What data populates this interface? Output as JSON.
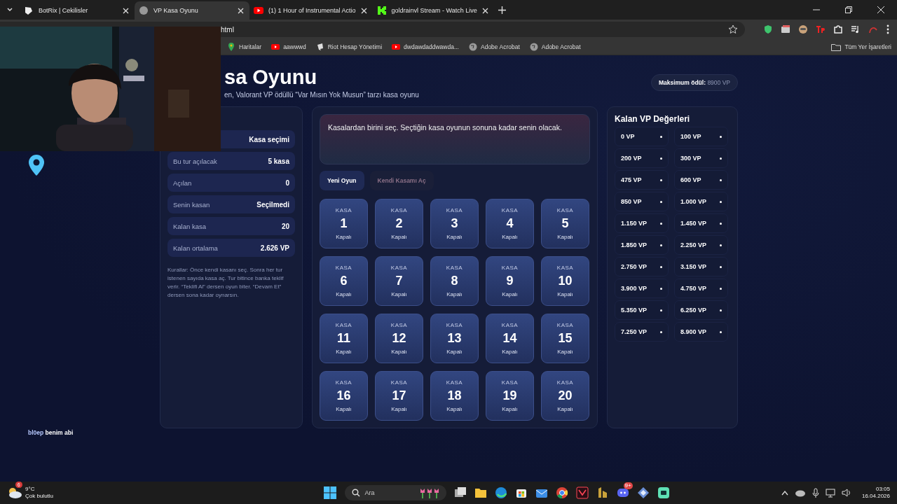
{
  "browser": {
    "tabs": [
      {
        "title": "BotRix | Cekilisler",
        "selected": false
      },
      {
        "title": "VP Kasa Oyunu",
        "selected": true
      },
      {
        "title": "(1) 1 Hour of Instrumental Actio",
        "selected": false
      },
      {
        "title": "goldrainvl Stream - Watch Live",
        "selected": false
      }
    ],
    "address": "html",
    "bookmarks": [
      "Haritalar",
      "aawwwd",
      "Riot Hesap Yönetimi",
      "dwdawdaddwawda...",
      "Adobe Acrobat",
      "Adobe Acrobat"
    ],
    "all_bookmarks": "Tüm Yer İşaretleri"
  },
  "page": {
    "title": "sa Oyunu",
    "subtitle": "en, Valorant VP ödüllü “Var Mısın Yok Musun” tarzı kasa oyunu",
    "max_prize": {
      "label": "Maksimum ödül:",
      "value": "8900 VP"
    },
    "status": {
      "rows": [
        {
          "label": "",
          "value": "Kasa seçimi"
        },
        {
          "label": "Bu tur açılacak",
          "value": "5 kasa"
        },
        {
          "label": "Açılan",
          "value": "0"
        },
        {
          "label": "Senin kasan",
          "value": "Seçilmedi"
        },
        {
          "label": "Kalan kasa",
          "value": "20"
        },
        {
          "label": "Kalan ortalama",
          "value": "2.626 VP"
        }
      ],
      "rules": "Kurallar: Önce kendi kasanı seç. Sonra her tur istenen sayıda kasa aç. Tur bitince banka teklif verir. “Teklifi Al” dersen oyun biter. “Devam Et” dersen sona kadar oynarsın."
    },
    "message": "Kasalardan birini seç. Seçtiğin kasa oyunun sonuna kadar senin olacak.",
    "buttons": [
      {
        "label": "Yeni Oyun",
        "disabled": false
      },
      {
        "label": "Kendi Kasamı Aç",
        "disabled": true
      }
    ],
    "cases": [
      {
        "top": "KASA",
        "number": "1",
        "state": "Kapalı",
        "opened": false
      },
      {
        "top": "KASA",
        "number": "2",
        "state": "Kapalı",
        "opened": false
      },
      {
        "top": "KASA",
        "number": "3",
        "state": "Kapalı",
        "opened": false
      },
      {
        "top": "KASA",
        "number": "4",
        "state": "Kapalı",
        "opened": false
      },
      {
        "top": "KASA",
        "number": "5",
        "state": "Kapalı",
        "opened": false
      },
      {
        "top": "KASA",
        "number": "6",
        "state": "Kapalı",
        "opened": false
      },
      {
        "top": "KASA",
        "number": "7",
        "state": "Kapalı",
        "opened": false
      },
      {
        "top": "KASA",
        "number": "8",
        "state": "Kapalı",
        "opened": false
      },
      {
        "top": "KASA",
        "number": "9",
        "state": "Kapalı",
        "opened": false
      },
      {
        "top": "KASA",
        "number": "10",
        "state": "Kapalı",
        "opened": false
      },
      {
        "top": "KASA",
        "number": "11",
        "state": "Kapalı",
        "opened": false
      },
      {
        "top": "KASA",
        "number": "12",
        "state": "Kapalı",
        "opened": false
      },
      {
        "top": "KASA",
        "number": "13",
        "state": "Kapalı",
        "opened": false
      },
      {
        "top": "KASA",
        "number": "14",
        "state": "Kapalı",
        "opened": false
      },
      {
        "top": "KASA",
        "number": "15",
        "state": "Kapalı",
        "opened": false
      },
      {
        "top": "KASA",
        "number": "16",
        "state": "Kapalı",
        "opened": false
      },
      {
        "top": "KASA",
        "number": "17",
        "state": "Kapalı",
        "opened": false
      },
      {
        "top": "KASA",
        "number": "18",
        "state": "Kapalı",
        "opened": false
      },
      {
        "top": "KASA",
        "number": "19",
        "state": "Kapalı",
        "opened": false
      },
      {
        "top": "KASA",
        "number": "20",
        "state": "Kapalı",
        "opened": false
      }
    ],
    "values_title": "Kalan VP Değerleri",
    "values": [
      {
        "label": "0 VP",
        "opened": false
      },
      {
        "label": "100 VP",
        "opened": false
      },
      {
        "label": "200 VP",
        "opened": false
      },
      {
        "label": "300 VP",
        "opened": false
      },
      {
        "label": "475 VP",
        "opened": false
      },
      {
        "label": "600 VP",
        "opened": false
      },
      {
        "label": "850 VP",
        "opened": false
      },
      {
        "label": "1.000 VP",
        "opened": false
      },
      {
        "label": "1.150 VP",
        "opened": false
      },
      {
        "label": "1.450 VP",
        "opened": false
      },
      {
        "label": "1.850 VP",
        "opened": false
      },
      {
        "label": "2.250 VP",
        "opened": false
      },
      {
        "label": "2.750 VP",
        "opened": false
      },
      {
        "label": "3.150 VP",
        "opened": false
      },
      {
        "label": "3.900 VP",
        "opened": false
      },
      {
        "label": "4.750 VP",
        "opened": false
      },
      {
        "label": "5.350 VP",
        "opened": false
      },
      {
        "label": "6.250 VP",
        "opened": false
      },
      {
        "label": "7.250 VP",
        "opened": false
      },
      {
        "label": "8.900 VP",
        "opened": false
      }
    ]
  },
  "overlay": {
    "chat": {
      "user": "bl0ep",
      "text": "benim abi"
    }
  },
  "taskbar": {
    "weather": {
      "badge": "6",
      "temp": "9°C",
      "desc": "Çok bulutlu"
    },
    "search": "Ara",
    "discord_badge": "9+",
    "time": "03:05",
    "date": "16.04.2026"
  }
}
